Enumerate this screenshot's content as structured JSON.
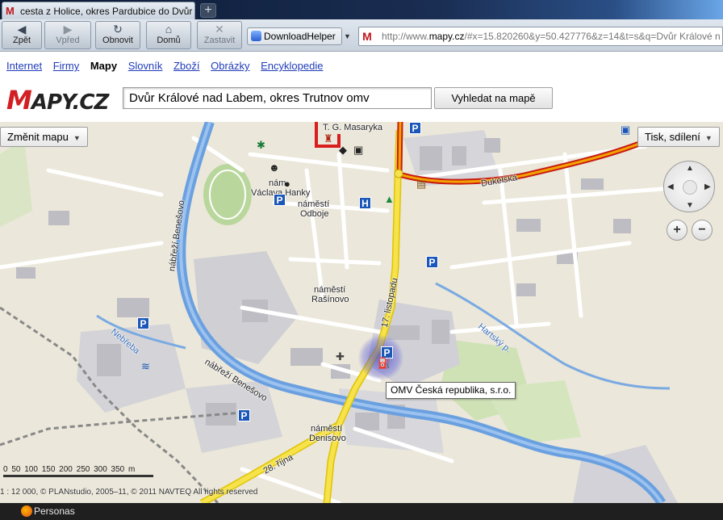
{
  "browser": {
    "tab_title": "cesta z Holice, okres Pardubice do Dvůr Králové nad Labem",
    "tab_favicon": "mapy-m-icon",
    "new_tab_symbol": "+",
    "nav": {
      "back": "Zpět",
      "forward": "Vpřed",
      "reload": "Obnovit",
      "home": "Domů",
      "stop": "Zastavit"
    },
    "downloadhelper": "DownloadHelper",
    "url_prefix": "http://www.",
    "url_domain": "mapy.cz",
    "url_rest": "/#x=15.820260&y=50.427776&z=14&t=s&q=Dvůr Králové n",
    "status_label": "Personas"
  },
  "portal": {
    "links": [
      "Internet",
      "Firmy",
      "Mapy",
      "Slovník",
      "Zboží",
      "Obrázky",
      "Encyklopedie"
    ],
    "current": "Mapy",
    "logo_m": "M",
    "logo_rest": "APY.CZ",
    "search_value": "Dvůr Králové nad Labem, okres Trutnov omv",
    "search_button": "Vyhledat na mapě"
  },
  "map": {
    "change_map": "Změnit mapu",
    "print_share": "Tisk, sdílení",
    "zoom_in": "+",
    "zoom_out": "−",
    "tooltip": "OMV Česká republika, s.r.o.",
    "labels": {
      "masaryka": "T. G. Masaryka",
      "vaclava_hanky_1": "nám.",
      "vaclava_hanky_2": "Václava Hanky",
      "odboje_1": "náměstí",
      "odboje_2": "Odboje",
      "dukelska": "Dukelská",
      "benesovo_top": "nábřeží Benešovo",
      "rasinovo_1": "náměstí",
      "rasinovo_2": "Rašínovo",
      "listopadu": "17. listopadu",
      "nebreba": "Nebřeba",
      "hartsky": "Hartský p.",
      "benesovo_bottom": "nábřeží Benešovo",
      "denisovo_1": "náměstí",
      "denisovo_2": "Denisovo",
      "rijna": "28. října"
    },
    "scale_ticks": "0  50  100  150  200  250  300  350 m",
    "copyright": "1 : 12 000, © PLANstudio, 2005–11, © 2011 NAVTEQ All rights reserved",
    "colors": {
      "route": "#e8231a",
      "main_road": "#f6e24a",
      "river": "#6aa0e0",
      "poi": "#1b57b8"
    }
  }
}
